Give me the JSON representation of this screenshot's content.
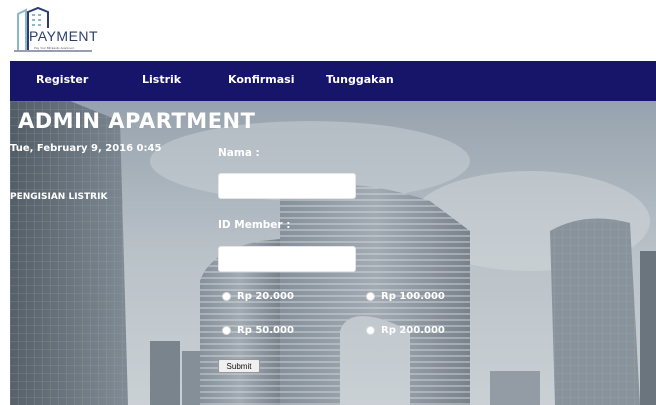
{
  "brand": {
    "logo_text": "PAYMENT",
    "tagline": "Pay Your Bill Easily Apartment"
  },
  "nav": {
    "items": [
      {
        "label": "Register"
      },
      {
        "label": "Listrik"
      },
      {
        "label": "Konfirmasi"
      },
      {
        "label": "Tunggakan"
      }
    ],
    "background": "#17156a"
  },
  "main": {
    "title": "ADMIN APARTMENT",
    "datetime": "Tue, February 9, 2016 0:45",
    "section": "PENGISIAN LISTRIK"
  },
  "form": {
    "nama_label": "Nama :",
    "nama_value": "",
    "id_label": "ID Member :",
    "id_value": "",
    "options": [
      {
        "label": "Rp 20.000"
      },
      {
        "label": "Rp 100.000"
      },
      {
        "label": "Rp 50.000"
      },
      {
        "label": "Rp 200.000"
      }
    ],
    "submit_label": "Submit"
  }
}
